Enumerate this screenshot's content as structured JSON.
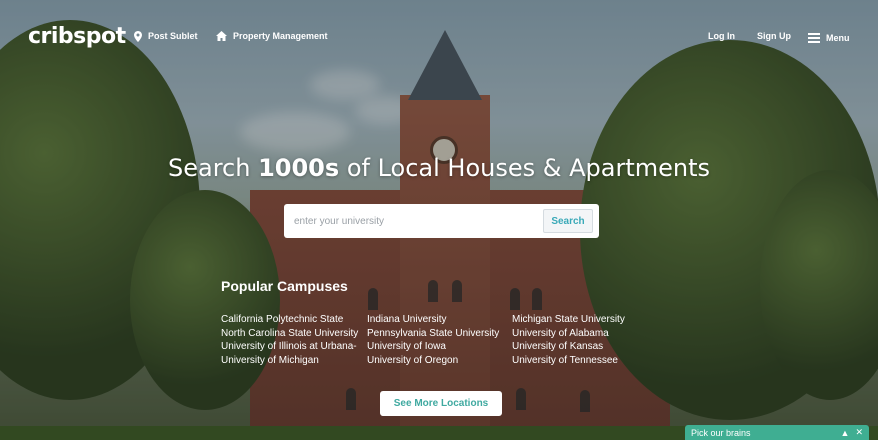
{
  "header": {
    "logo": "cribspot",
    "nav": {
      "post_sublet": "Post Sublet",
      "property_management": "Property Management",
      "log_in": "Log In",
      "sign_up": "Sign Up",
      "menu": "Menu"
    }
  },
  "hero": {
    "title_prefix": "Search",
    "title_bold": "1000s",
    "title_suffix": "of Local Houses & Apartments",
    "search": {
      "placeholder": "enter your university",
      "value": "",
      "button_label": "Search"
    }
  },
  "campuses": {
    "title": "Popular Campuses",
    "columns": [
      [
        "California Polytechnic State",
        "North Carolina State University",
        "University of Illinois at Urbana-",
        "University of Michigan"
      ],
      [
        "Indiana University",
        "Pennsylvania State University",
        "University of Iowa",
        "University of Oregon"
      ],
      [
        "Michigan State University",
        "University of Alabama",
        "University of Kansas",
        "University of Tennessee"
      ]
    ],
    "more_button": "See More Locations"
  },
  "chat": {
    "label": "Pick our brains",
    "collapse_icon": "chevron-up-icon",
    "close_icon": "close-icon"
  },
  "colors": {
    "accent": "#3fae92",
    "search_button_text": "#3aa9b8"
  }
}
